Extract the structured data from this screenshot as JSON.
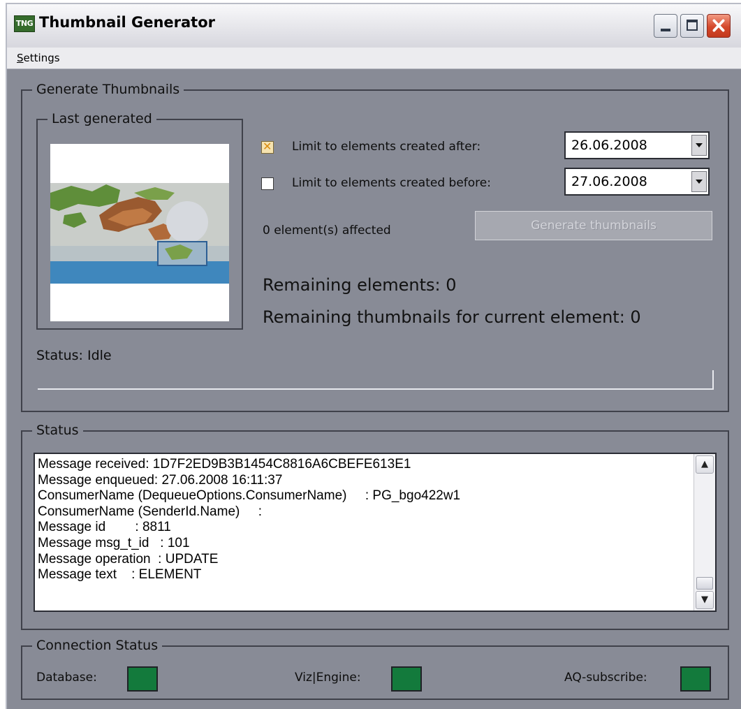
{
  "window": {
    "title": "Thumbnail Generator",
    "app_icon_text": "TNG"
  },
  "menu": {
    "settings_prefix": "S",
    "settings_rest": "ettings"
  },
  "generate_group": {
    "legend": "Generate Thumbnails",
    "last_generated_legend": "Last generated",
    "limit_after": {
      "label": "Limit to elements created after:",
      "checked": true,
      "date": "26.06.2008"
    },
    "limit_before": {
      "label": "Limit to elements created before:",
      "checked": false,
      "date": "27.06.2008"
    },
    "affected": "0 element(s) affected",
    "generate_button": "Generate thumbnails",
    "remaining_elements": "Remaining elements: 0",
    "remaining_thumbnails": "Remaining thumbnails for current element: 0",
    "status": "Status: Idle",
    "progress": 0
  },
  "status_group": {
    "legend": "Status",
    "lines": [
      "Message received: 1D7F2ED9B3B1454C8816A6CBEFE613E1",
      "Message enqueued: 27.06.2008 16:11:37",
      "ConsumerName (DequeueOptions.ConsumerName)     : PG_bgo422w1",
      "ConsumerName (SenderId.Name)     :",
      "Message id        : 8811",
      "Message msg_t_id   : 101",
      "Message operation  : UPDATE",
      "Message text    : ELEMENT"
    ]
  },
  "connection_group": {
    "legend": "Connection Status",
    "database_label": "Database:",
    "vizengine_label": "Viz|Engine:",
    "aq_label": "AQ-subscribe:",
    "ok_color": "#137a3c"
  },
  "colors": {
    "window_bg": "#888b96",
    "accent_check": "#d98c10"
  }
}
